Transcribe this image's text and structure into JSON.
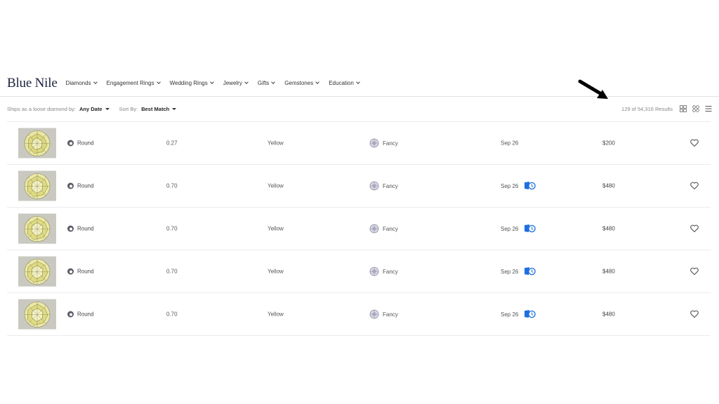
{
  "brand": {
    "logo_text": "Blue Nile"
  },
  "nav": {
    "items": [
      "Diamonds",
      "Engagement Rings",
      "Wedding Rings",
      "Jewelry",
      "Gifts",
      "Gemstones",
      "Education"
    ]
  },
  "filters": {
    "ships_label": "Ships as a loose diamond by:",
    "ships_value": "Any Date",
    "sort_label": "Sort By:",
    "sort_value": "Best Match",
    "results_text": "129 of 54,316 Results"
  },
  "colors": {
    "brand": "#1c2340",
    "accent_blue": "#1f6fe0",
    "border": "#ececec"
  },
  "rows": [
    {
      "shape": "Round",
      "carat": "0.27",
      "color": "Yellow",
      "clarity": "Fancy",
      "date": "Sep 26",
      "price": "$200",
      "express": false
    },
    {
      "shape": "Round",
      "carat": "0.70",
      "color": "Yellow",
      "clarity": "Fancy",
      "date": "Sep 26",
      "price": "$480",
      "express": true
    },
    {
      "shape": "Round",
      "carat": "0.70",
      "color": "Yellow",
      "clarity": "Fancy",
      "date": "Sep 26",
      "price": "$480",
      "express": true
    },
    {
      "shape": "Round",
      "carat": "0.70",
      "color": "Yellow",
      "clarity": "Fancy",
      "date": "Sep 26",
      "price": "$480",
      "express": true
    },
    {
      "shape": "Round",
      "carat": "0.70",
      "color": "Yellow",
      "clarity": "Fancy",
      "date": "Sep 26",
      "price": "$480",
      "express": true
    }
  ],
  "icons": {
    "view_grid_large": "grid-large-icon",
    "view_grid_small": "grid-small-icon",
    "view_list": "list-icon",
    "wishlist": "heart-icon",
    "express_shipping": "express-shipping-icon",
    "clarity": "clarity-icon",
    "shape": "round-shape-icon",
    "annotation": "arrow-icon"
  }
}
